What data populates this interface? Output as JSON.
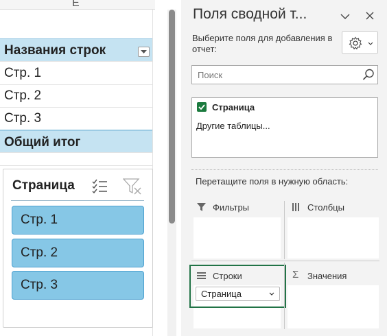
{
  "sheet": {
    "column_letter": "E",
    "pivot": {
      "header": "Названия строк",
      "rows": [
        "Стр. 1",
        "Стр. 2",
        "Стр. 3"
      ],
      "total": "Общий итог"
    },
    "slicer": {
      "title": "Страница",
      "items": [
        "Стр. 1",
        "Стр. 2",
        "Стр. 3"
      ],
      "multiselect_icon": "multiselect-icon",
      "clear_filter_icon": "clear-filter-icon"
    }
  },
  "panel": {
    "title": "Поля сводной т...",
    "instruction": "Выберите поля для добавления в отчет:",
    "search_placeholder": "Поиск",
    "fields": [
      {
        "name": "Страница",
        "checked": true
      }
    ],
    "other_tables": "Другие таблицы...",
    "drag_label": "Перетащите поля в нужную область:",
    "areas": {
      "filters": "Фильтры",
      "columns": "Столбцы",
      "rows": "Строки",
      "values": "Значения"
    },
    "rows_field": "Страница"
  },
  "colors": {
    "pivot_header_bg": "#c5e3f2",
    "slicer_item_bg": "#86c7e6",
    "checkbox_green": "#1b7a3e",
    "rows_area_highlight": "#217346"
  }
}
